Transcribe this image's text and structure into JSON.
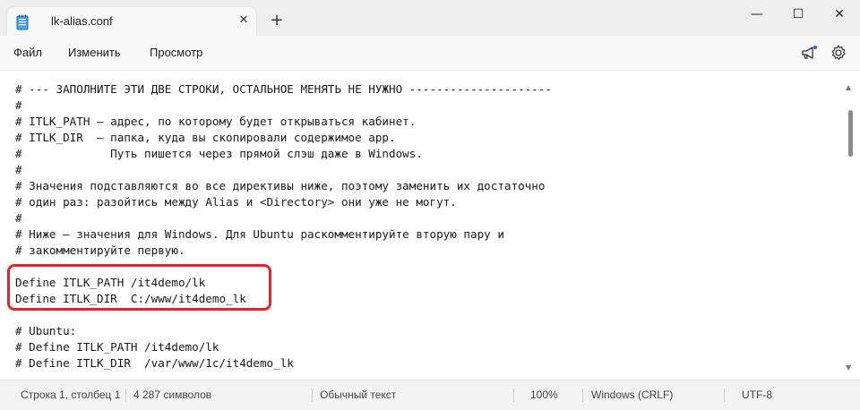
{
  "tab": {
    "title": "lk-alias.conf",
    "icon": "notepad-icon",
    "close_symbol": "✕"
  },
  "window": {
    "new_tab_symbol": "+",
    "minimize_symbol": "—",
    "maximize_symbol": "☐",
    "close_symbol": "✕"
  },
  "menu": {
    "file": "Файл",
    "edit": "Изменить",
    "view": "Просмотр",
    "right_icons": [
      "megaphone-icon",
      "gear-icon"
    ]
  },
  "editor": {
    "lines": [
      "# --- ЗАПОЛНИТЕ ЭТИ ДВЕ СТРОКИ, ОСТАЛЬНОЕ МЕНЯТЬ НЕ НУЖНО ---------------------",
      "#",
      "# ITLK_PATH — адрес, по которому будет открываться кабинет.",
      "# ITLK_DIR  — папка, куда вы скопировали содержимое app.",
      "#             Путь пишется через прямой слэш даже в Windows.",
      "#",
      "# Значения подставляются во все директивы ниже, поэтому заменить их достаточно",
      "# один раз: разойтись между Alias и <Directory> они уже не могут.",
      "#",
      "# Ниже — значения для Windows. Для Ubuntu раскомментируйте вторую пару и",
      "# закомментируйте первую.",
      "",
      "Define ITLK_PATH /it4demo/lk",
      "Define ITLK_DIR  C:/www/it4demo_lk",
      "",
      "# Ubuntu:",
      "# Define ITLK_PATH /it4demo/lk",
      "# Define ITLK_DIR  /var/www/1c/it4demo_lk"
    ],
    "highlight_color": "#e0262b"
  },
  "status": {
    "position": "Строка 1, столбец 1",
    "chars": "4 287 символов",
    "format": "Обычный текст",
    "zoom": "100%",
    "line_endings": "Windows (CRLF)",
    "encoding": "UTF-8"
  }
}
